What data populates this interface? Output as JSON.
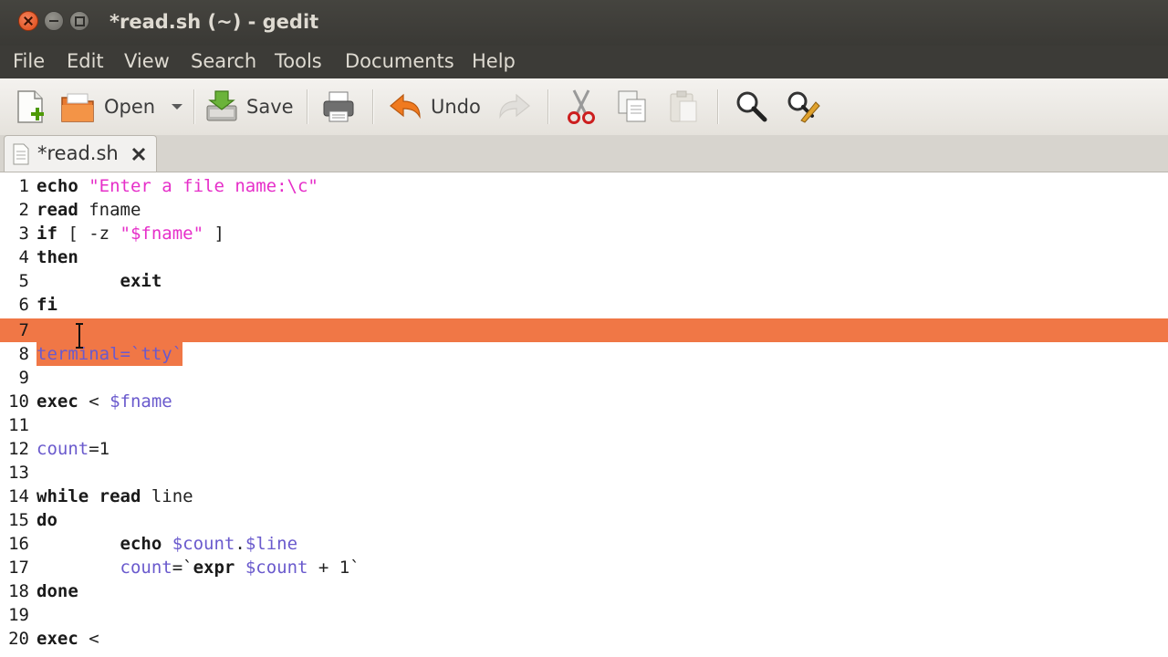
{
  "window": {
    "title": "*read.sh (~) - gedit"
  },
  "menu": [
    "File",
    "Edit",
    "View",
    "Search",
    "Tools",
    "Documents",
    "Help"
  ],
  "toolbar": {
    "open_label": "Open",
    "save_label": "Save",
    "undo_label": "Undo"
  },
  "tab": {
    "label": "*read.sh"
  },
  "editor": {
    "highlight_color": "#f07746",
    "lines": [
      {
        "n": "1",
        "t": "echo \"Enter a file name:\\c\""
      },
      {
        "n": "2",
        "t": "read fname"
      },
      {
        "n": "3",
        "t": "if [ -z \"$fname\" ]"
      },
      {
        "n": "4",
        "t": "then"
      },
      {
        "n": "5",
        "t": "        exit"
      },
      {
        "n": "6",
        "t": "fi"
      },
      {
        "n": "7",
        "t": ""
      },
      {
        "n": "8",
        "t": "terminal=`tty`"
      },
      {
        "n": "9",
        "t": ""
      },
      {
        "n": "10",
        "t": "exec < $fname"
      },
      {
        "n": "11",
        "t": ""
      },
      {
        "n": "12",
        "t": "count=1"
      },
      {
        "n": "13",
        "t": ""
      },
      {
        "n": "14",
        "t": "while read line"
      },
      {
        "n": "15",
        "t": "do"
      },
      {
        "n": "16",
        "t": "        echo $count.$line"
      },
      {
        "n": "17",
        "t": "        count=`expr $count + 1`"
      },
      {
        "n": "18",
        "t": "done"
      },
      {
        "n": "19",
        "t": ""
      },
      {
        "n": "20",
        "t": "exec <"
      }
    ]
  }
}
